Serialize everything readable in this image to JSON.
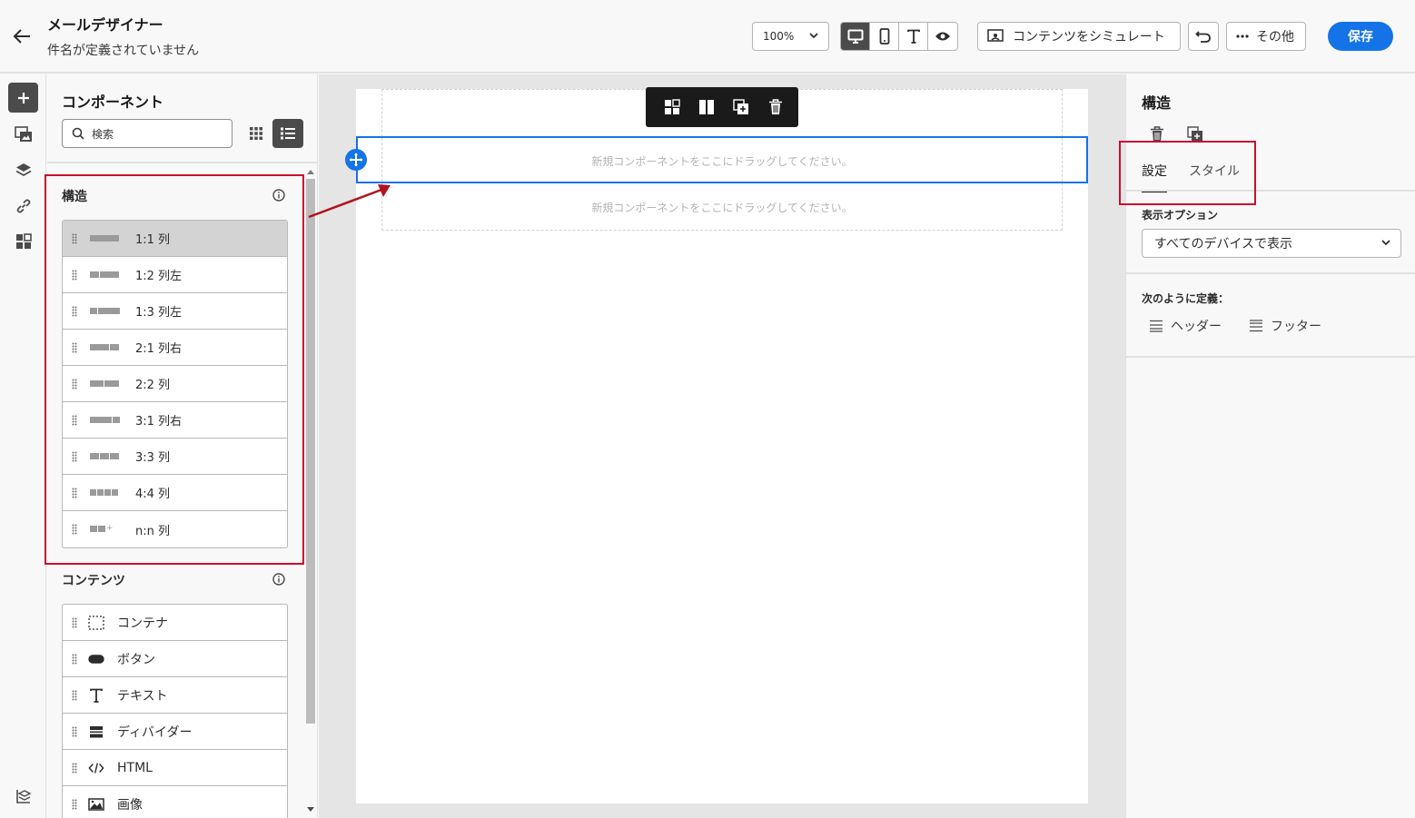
{
  "header": {
    "title": "メールデザイナー",
    "subtitle": "件名が定義されていません",
    "zoom": "100%",
    "simulate_label": "コンテンツをシミュレート",
    "more_label": "その他",
    "save_label": "保存"
  },
  "components": {
    "title": "コンポーネント",
    "search_placeholder": "検索",
    "structure_heading": "構造",
    "structures": [
      {
        "label": "1:1 列",
        "cols": 1
      },
      {
        "label": "1:2 列左",
        "cols": 2
      },
      {
        "label": "1:3 列左",
        "cols": 2
      },
      {
        "label": "2:1 列右",
        "cols": 2
      },
      {
        "label": "2:2 列",
        "cols": 2
      },
      {
        "label": "3:1 列右",
        "cols": 2
      },
      {
        "label": "3:3 列",
        "cols": 3
      },
      {
        "label": "4:4 列",
        "cols": 4
      },
      {
        "label": "n:n 列",
        "cols": 0
      }
    ],
    "content_heading": "コンテンツ",
    "contents": [
      {
        "label": "コンテナ",
        "icon": "container-icon"
      },
      {
        "label": "ボタン",
        "icon": "button-icon"
      },
      {
        "label": "テキスト",
        "icon": "text-icon"
      },
      {
        "label": "ディバイダー",
        "icon": "divider-icon"
      },
      {
        "label": "HTML",
        "icon": "html-icon"
      },
      {
        "label": "画像",
        "icon": "image-icon"
      }
    ]
  },
  "canvas": {
    "drop_text_1": "新規コンポーネントをここにドラッグしてください。",
    "drop_text_2": "新規コンポーネントをここにドラッグしてください。"
  },
  "properties": {
    "title": "構造",
    "tabs": [
      {
        "label": "設定",
        "active": true
      },
      {
        "label": "スタイル",
        "active": false
      }
    ],
    "display_options_label": "表示オプション",
    "display_options_value": "すべてのデバイスで表示",
    "define_as_label": "次のように定義：",
    "header_label": "ヘッダー",
    "footer_label": "フッター"
  },
  "colors": {
    "accent": "#1473e6",
    "highlight": "#c8102e",
    "dark": "#4b4b4b"
  }
}
